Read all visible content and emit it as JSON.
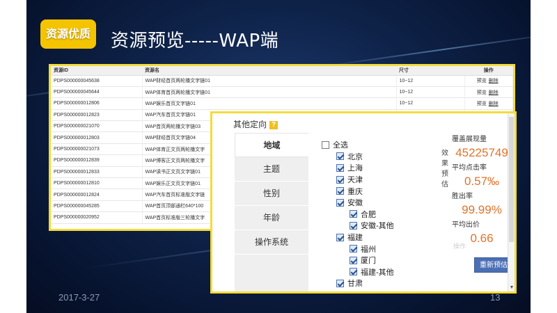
{
  "slide": {
    "badge": "资源优质",
    "title": "资源预览-----WAP端",
    "date": "2017-3-27",
    "page_number": "13"
  },
  "resource_table": {
    "columns": [
      "资源ID",
      "资源名",
      "尺寸",
      "操作"
    ],
    "rows": [
      {
        "id": "PDPS000000045638",
        "name": "WAP财经首页两轮播文字链01",
        "size": "10~12",
        "preview": "预览",
        "delete": "删除"
      },
      {
        "id": "PDPS000000045644",
        "name": "WAP体育首页两轮播文字链01",
        "size": "10~12",
        "preview": "预览",
        "delete": "删除"
      },
      {
        "id": "PDPS000000012806",
        "name": "WAP娱乐首页文字链01",
        "size": "10~12",
        "preview": "预览",
        "delete": "删除"
      },
      {
        "id": "PDPS000000012823",
        "name": "WAP汽车首页文字链01",
        "size": "",
        "preview": "",
        "delete": ""
      },
      {
        "id": "PDPS000000021070",
        "name": "WAP首页两轮播文字链03",
        "size": "",
        "preview": "",
        "delete": ""
      },
      {
        "id": "PDPS000000012803",
        "name": "WAP财经首页文字链04",
        "size": "",
        "preview": "",
        "delete": ""
      },
      {
        "id": "PDPS000000021073",
        "name": "WAP体育正文页两轮播文字",
        "size": "",
        "preview": "",
        "delete": ""
      },
      {
        "id": "PDPS000000012839",
        "name": "WAP博客正文页两轮播文字",
        "size": "",
        "preview": "",
        "delete": ""
      },
      {
        "id": "PDPS000000012833",
        "name": "WAP读书正文页文字链01",
        "size": "",
        "preview": "",
        "delete": ""
      },
      {
        "id": "PDPS000000012810",
        "name": "WAP娱乐正文页文字链01",
        "size": "",
        "preview": "",
        "delete": ""
      },
      {
        "id": "PDPS000000012824",
        "name": "WAP汽车首页标准版文字链",
        "size": "",
        "preview": "",
        "delete": ""
      },
      {
        "id": "PDPS000000045285",
        "name": "WAP首页顶部通栏640*100",
        "size": "",
        "preview": "",
        "delete": ""
      },
      {
        "id": "PDPS000000020952",
        "name": "WAP首页标准版三轮播文字",
        "size": "",
        "preview": "",
        "delete": ""
      }
    ]
  },
  "targeting": {
    "header": "其他定向",
    "help_icon": "?",
    "tabs": [
      "地域",
      "主题",
      "性别",
      "年龄",
      "操作系统"
    ],
    "active_tab": "地域",
    "regions": [
      {
        "label": "全选",
        "checked": false,
        "level": 0
      },
      {
        "label": "北京",
        "checked": true,
        "level": 1
      },
      {
        "label": "上海",
        "checked": true,
        "level": 1
      },
      {
        "label": "天津",
        "checked": true,
        "level": 1
      },
      {
        "label": "重庆",
        "checked": true,
        "level": 1
      },
      {
        "label": "安徽",
        "checked": true,
        "level": 1
      },
      {
        "label": "合肥",
        "checked": true,
        "level": 2
      },
      {
        "label": "安徽-其他",
        "checked": true,
        "level": 2
      },
      {
        "label": "福建",
        "checked": true,
        "level": 1
      },
      {
        "label": "福州",
        "checked": true,
        "level": 2
      },
      {
        "label": "厦门",
        "checked": true,
        "level": 2
      },
      {
        "label": "福建-其他",
        "checked": true,
        "level": 2
      },
      {
        "label": "甘肃",
        "checked": true,
        "level": 1
      }
    ],
    "side_strip": [
      "效",
      "果",
      "预",
      "估"
    ],
    "stats": {
      "coverage_label": "覆盖展现量",
      "coverage_value": "45225749",
      "ctr_label": "平均点击率",
      "ctr_value": "0.57‰",
      "win_label": "胜出率",
      "win_value": "99.99%",
      "bid_label": "平均出价",
      "bid_value": "0.66",
      "ghost_op": "操作",
      "rerun_button": "重新预估"
    },
    "scroll_arrow": "▼"
  },
  "colors": {
    "badge": "#f5c400",
    "panel_border": "#f2dc3a",
    "stat_value": "#e0732a",
    "button": "#4b6fb4"
  }
}
